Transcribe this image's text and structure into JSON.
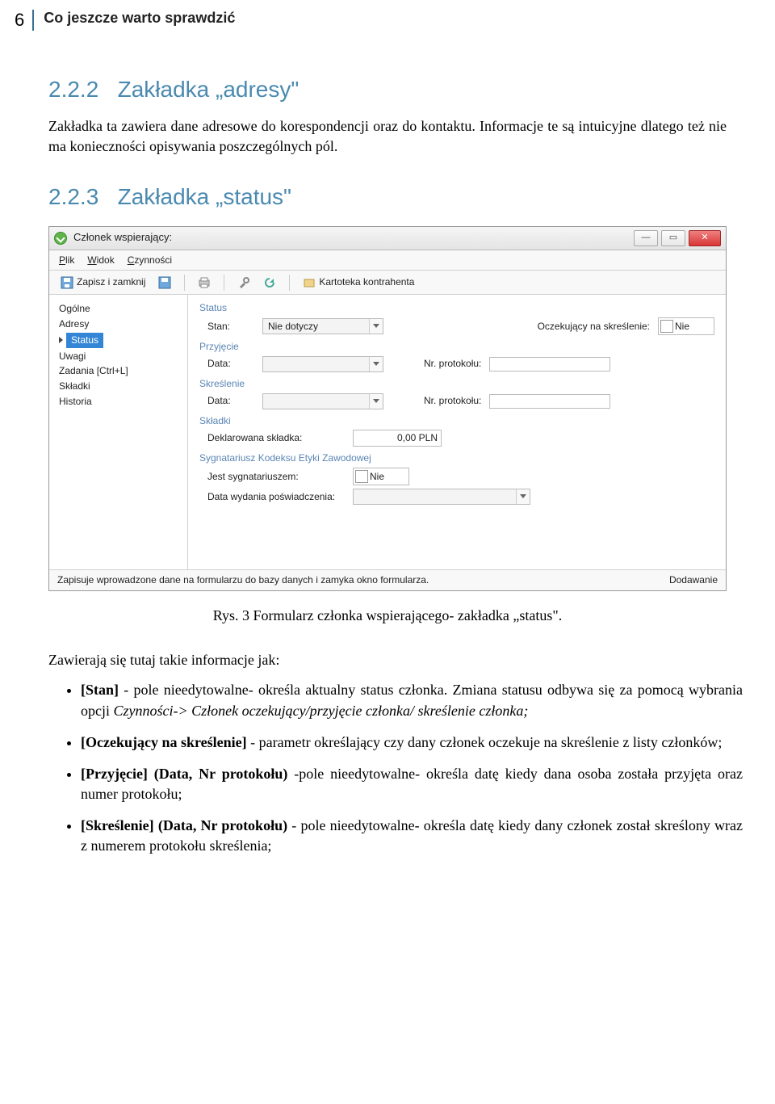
{
  "header": {
    "page_number": "6",
    "running_title": "Co jeszcze warto sprawdzić"
  },
  "section1": {
    "number": "2.2.2",
    "title": "Zakładka „adresy\"",
    "paragraph": "Zakładka ta zawiera dane adresowe do korespondencji oraz do kontaktu. Informacje te są intuicyjne dlatego też nie ma konieczności opisywania poszczególnych pól."
  },
  "section2": {
    "number": "2.2.3",
    "title": "Zakładka „status\""
  },
  "window": {
    "title": "Członek wspierający:",
    "menubar": {
      "plik": "Plik",
      "widok": "Widok",
      "czynnosci": "Czynności"
    },
    "toolbar": {
      "save_close": "Zapisz i zamknij",
      "kartoteka": "Kartoteka kontrahenta"
    },
    "sidebar": {
      "items": [
        {
          "label": "Ogólne"
        },
        {
          "label": "Adresy"
        },
        {
          "label": "Status"
        },
        {
          "label": "Uwagi"
        },
        {
          "label": "Zadania [Ctrl+L]"
        },
        {
          "label": "Składki"
        },
        {
          "label": "Historia"
        }
      ]
    },
    "form": {
      "status": {
        "title": "Status",
        "stan_label": "Stan:",
        "stan_value": "Nie dotyczy",
        "oczek_label": "Oczekujący na skreślenie:",
        "oczek_value": "Nie"
      },
      "przyjecie": {
        "title": "Przyjęcie",
        "data_label": "Data:",
        "nr_label": "Nr. protokołu:"
      },
      "skreslenie": {
        "title": "Skreślenie",
        "data_label": "Data:",
        "nr_label": "Nr. protokołu:"
      },
      "skladki": {
        "title": "Składki",
        "dekl_label": "Deklarowana składka:",
        "dekl_value": "0,00 PLN"
      },
      "sygnatariusz": {
        "title": "Sygnatariusz Kodeksu Etyki Zawodowej",
        "jest_label": "Jest sygnatariuszem:",
        "jest_value": "Nie",
        "data_posw_label": "Data wydania poświadczenia:"
      }
    },
    "statusbar": {
      "left": "Zapisuje wprowadzone dane na formularzu do bazy danych i zamyka okno formularza.",
      "right": "Dodawanie"
    }
  },
  "caption": "Rys. 3 Formularz członka wspierającego- zakładka „status\".",
  "intro_line": "Zawierają się tutaj takie informacje jak:",
  "bullets": {
    "b1_bold": "[Stan]",
    "b1_rest_a": " - pole nieedytowalne- określa aktualny status członka. Zmiana statusu odbywa się za pomocą wybrania opcji ",
    "b1_italic": "Czynności-> Członek oczekujący/przyjęcie członka/ skreślenie członka;",
    "b2_bold": "[Oczekujący na skreślenie]",
    "b2_rest": " - parametr określający czy dany członek oczekuje na skreślenie z listy członków;",
    "b3_bold": "[Przyjęcie] (Data, Nr protokołu)",
    "b3_rest": " -pole nieedytowalne-  określa datę kiedy dana osoba została przyjęta oraz numer protokołu;",
    "b4_bold": "[Skreślenie] (Data, Nr protokołu)",
    "b4_rest": " - pole nieedytowalne- określa datę kiedy dany członek został skreślony wraz z numerem protokołu skreślenia;"
  }
}
